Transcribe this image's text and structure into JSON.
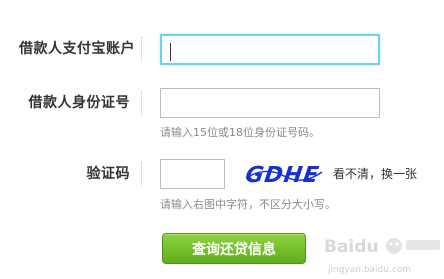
{
  "form": {
    "alipay_label": "借款人支付宝账户",
    "id_label": "借款人身份证号",
    "id_hint": "请输入15位或18位身份证号码。",
    "code_label": "验证码",
    "captcha_text": "GDHE",
    "refresh_label": "看不清，换一张",
    "code_hint": "请输入右图中字符，不区分大小写。",
    "submit_label": "查询还贷信息"
  },
  "watermark": {
    "brand": "Baidu",
    "site": "jingyan.baidu.com"
  },
  "colors": {
    "focus_border": "#6ad3f3",
    "captcha_blue": "#1730d6",
    "button_green": "#6dbc28"
  }
}
